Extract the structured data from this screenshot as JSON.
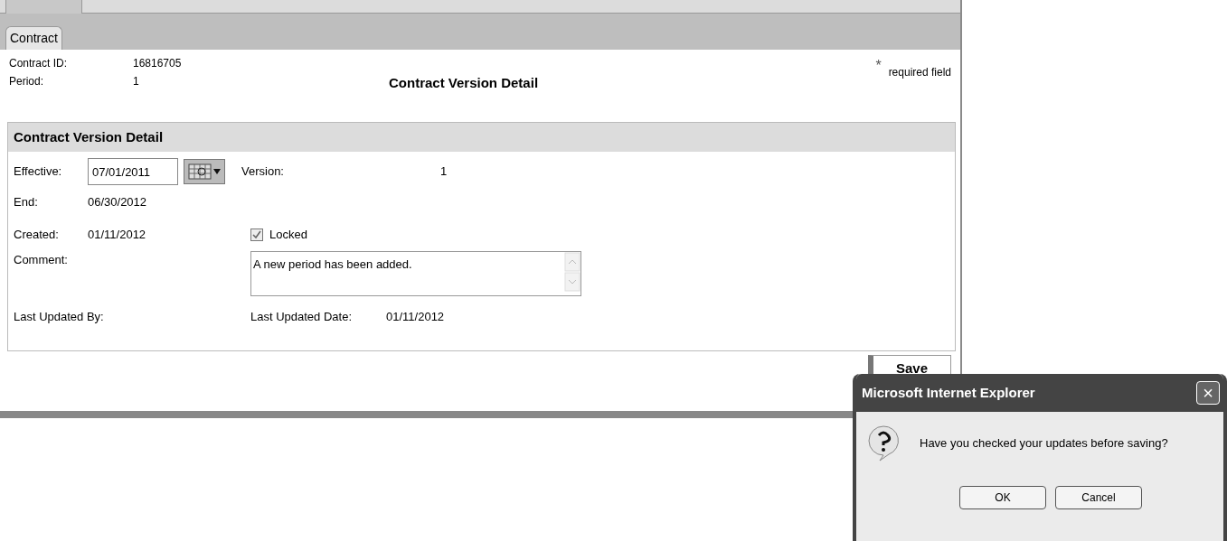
{
  "tabs": [
    {
      "label": "Contract",
      "selected": true
    }
  ],
  "header": {
    "fields": [
      {
        "label": "Contract ID:",
        "value": "16816705"
      },
      {
        "label": "Period:",
        "value": "1"
      }
    ],
    "title": "Contract Version Detail",
    "required_mark": "*",
    "required_note": "required field"
  },
  "section": {
    "title": "Contract Version Detail",
    "effective_label": "Effective:",
    "effective_value": "07/01/2011",
    "version_label": "Version:",
    "version_value": "1",
    "end_label": "End:",
    "end_value": "06/30/2012",
    "created_label": "Created:",
    "created_value": "01/11/2012",
    "locked": {
      "label": "Locked",
      "checked": true
    },
    "comment_label": "Comment:",
    "comment_value": "A new period has been added.",
    "updated_by_label": "Last Updated By:",
    "updated_date_label": "Last Updated Date:",
    "updated_date_value": "01/11/2012"
  },
  "save_button": "Save",
  "dialog": {
    "title": "Microsoft Internet Explorer",
    "close": "×",
    "message": "Have you checked your updates before saving?",
    "buttons": [
      "OK",
      "Cancel"
    ]
  }
}
